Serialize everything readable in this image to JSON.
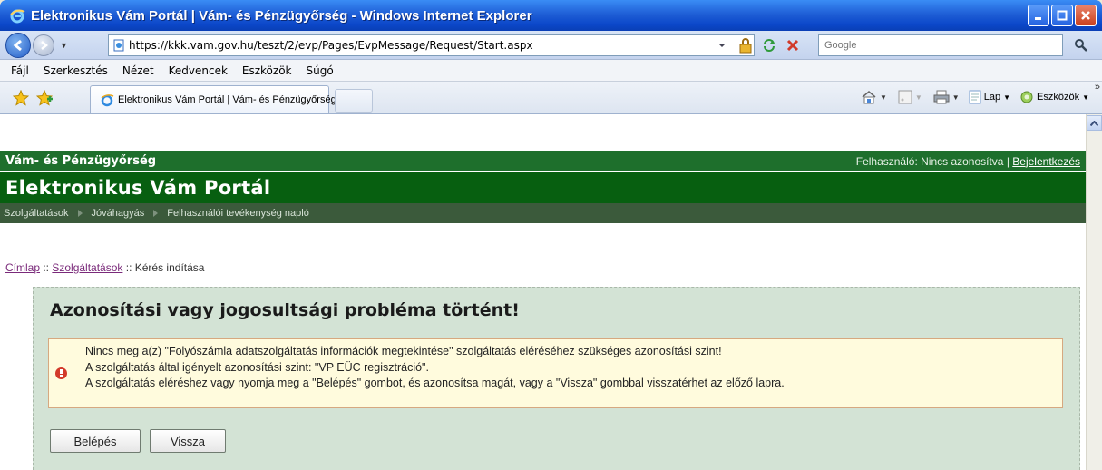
{
  "window": {
    "title": "Elektronikus Vám Portál | Vám- és Pénzügyőrség - Windows Internet Explorer"
  },
  "address": {
    "url": "https://kkk.vam.gov.hu/teszt/2/evp/Pages/EvpMessage/Request/Start.aspx",
    "search_placeholder": "Google"
  },
  "menu": [
    "Fájl",
    "Szerkesztés",
    "Nézet",
    "Kedvencek",
    "Eszközök",
    "Súgó"
  ],
  "tab": {
    "label": "Elektronikus Vám Portál | Vám- és Pénzügyőrség"
  },
  "commandbar": {
    "page": "Lap",
    "tools": "Eszközök"
  },
  "site": {
    "org": "Vám- és Pénzügyőrség",
    "user_prefix": "Felhasználó: Nincs azonosítva | ",
    "login_link": "Bejelentkezés",
    "portal_title": "Elektronikus Vám Portál",
    "nav": [
      "Szolgáltatások",
      "Jóváhagyás",
      "Felhasználói tevékenység napló"
    ]
  },
  "breadcrumb": {
    "home": "Címlap",
    "sep1": " :: ",
    "services": "Szolgáltatások",
    "sep2": " :: ",
    "current": "Kérés indítása"
  },
  "error": {
    "heading": "Azonosítási vagy jogosultsági probléma történt!",
    "line1": "Nincs meg a(z) \"Folyószámla adatszolgáltatás információk megtekintése\" szolgáltatás eléréséhez szükséges azonosítási szint!",
    "line2": "A szolgáltatás által igényelt azonosítási szint: \"VP EÜC regisztráció\".",
    "line3": "A szolgáltatás eléréshez vagy nyomja meg a \"Belépés\" gombot, és azonosítsa magát, vagy a \"Vissza\" gombbal visszatérhet az előző lapra."
  },
  "buttons": {
    "login": "Belépés",
    "back": "Vissza"
  }
}
